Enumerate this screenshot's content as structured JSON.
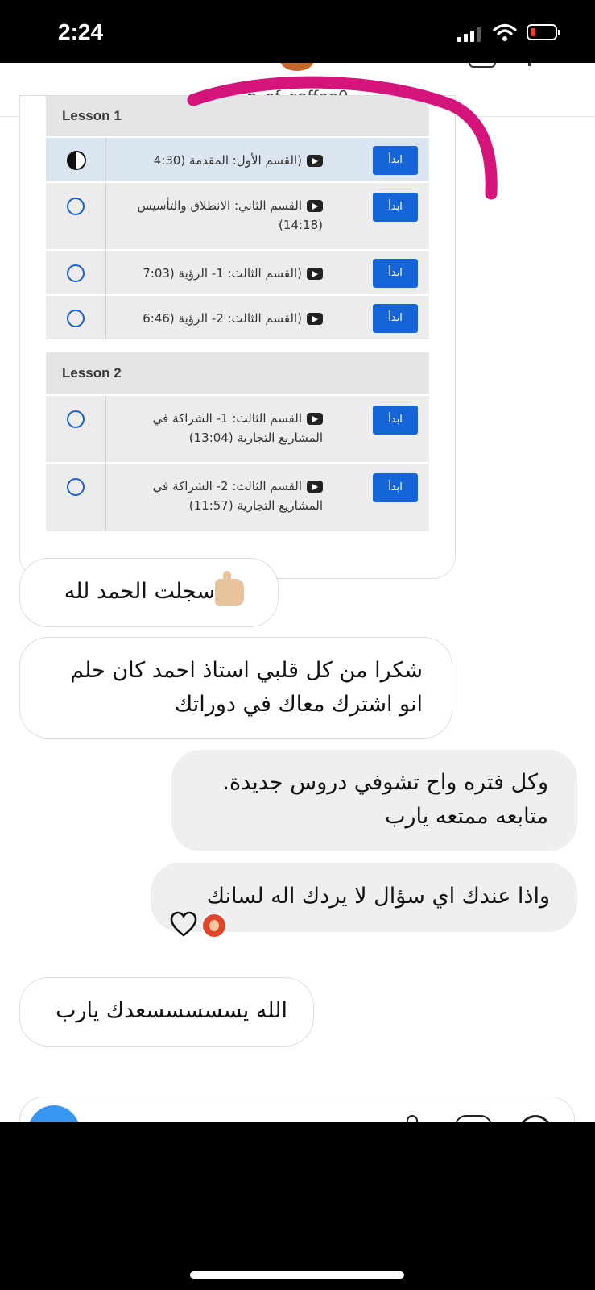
{
  "status_bar": {
    "time": "2:24",
    "battery_level": 0.15
  },
  "header": {
    "username_visible": "...n_of_coffee0..."
  },
  "shared_course": {
    "lessons": [
      {
        "label": "Lesson 1",
        "items": [
          {
            "title": "(القسم الأول: المقدمة (4:30",
            "button": "ابدأ",
            "status": "in-progress"
          },
          {
            "title": "القسم الثاني: الانطلاق والتأسيس (14:18)",
            "button": "ابدأ",
            "status": "not-started"
          },
          {
            "title": "(القسم الثالث: 1- الرؤية (7:03",
            "button": "ابدأ",
            "status": "not-started"
          },
          {
            "title": "(القسم الثالث: 2- الرؤية (6:46",
            "button": "ابدأ",
            "status": "not-started"
          }
        ]
      },
      {
        "label": "Lesson 2",
        "items": [
          {
            "title": "القسم الثالث: 1- الشراكة في المشاريع التجارية (13:04)",
            "button": "ابدأ",
            "status": "not-started"
          },
          {
            "title": "القسم الثالث: 2- الشراكة في المشاريع التجارية (11:57)",
            "button": "ابدأ",
            "status": "not-started"
          }
        ]
      }
    ]
  },
  "messages": [
    {
      "direction": "in",
      "text": "سجلت الحمد لله",
      "emoji": "thumbs-up"
    },
    {
      "direction": "in",
      "text": "شكرا من كل قلبي استاذ احمد كان حلم انو اشترك معاك في دوراتك"
    },
    {
      "direction": "out",
      "text": "وكل فتره واح تشوفي دروس جديدة. متابعه ممتعه يارب"
    },
    {
      "direction": "out",
      "text": "واذا عندك اي سؤال لا يردك اله لسانك"
    },
    {
      "direction": "in",
      "text": "الله يسسسسسعدك يارب"
    }
  ],
  "reaction": {
    "icon": "heart-outline-icon"
  },
  "colors": {
    "accent_blue": "#1565d8",
    "scribble_magenta": "#d4147a",
    "bubble_out": "#efefef",
    "ig_blue": "#3797f0"
  }
}
